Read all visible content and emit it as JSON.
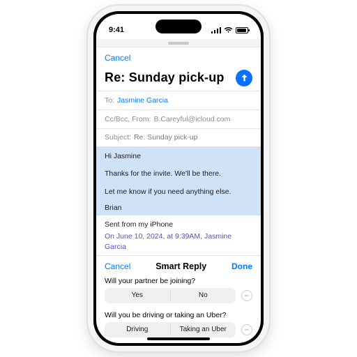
{
  "status": {
    "time": "9:41"
  },
  "nav": {
    "cancel": "Cancel"
  },
  "title": "Re: Sunday pick-up",
  "to": {
    "label": "To:",
    "recipient": "Jasmine Garcia"
  },
  "ccfrom": {
    "label": "Cc/Bcc, From:",
    "address": "B.Careyful@icloud.com"
  },
  "subject": {
    "label": "Subject:",
    "value": "Re: Sunday pick-up"
  },
  "body": {
    "greeting": "Hi Jasmine",
    "p1": "Thanks for the invite. We'll be there.",
    "p2": "Let me know if you need anything else.",
    "signoff": "Brian",
    "signature": "Sent from my iPhone",
    "quoted": "On June 10, 2024, at 9:39AM, Jasmine Garcia"
  },
  "smart": {
    "cancel": "Cancel",
    "title": "Smart Reply",
    "done": "Done",
    "q1": {
      "text": "Will your partner be joining?",
      "optA": "Yes",
      "optB": "No"
    },
    "q2": {
      "text": "Will you be driving or taking an Uber?",
      "optA": "Driving",
      "optB": "Taking an Uber"
    }
  },
  "colors": {
    "accent": "#007aff",
    "send": "#0a72ff",
    "selection": "#cfe2f6"
  }
}
